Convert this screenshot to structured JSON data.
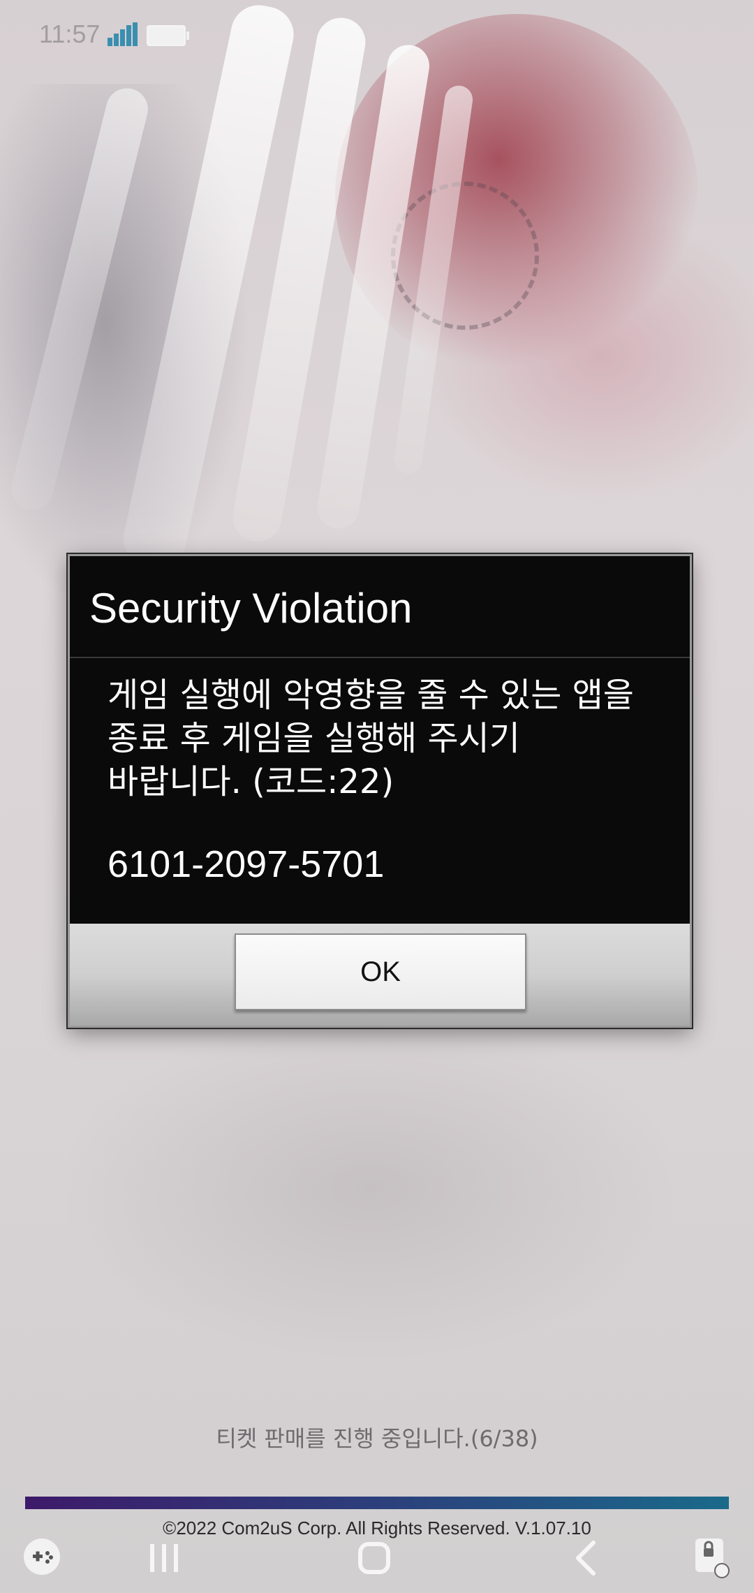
{
  "status_bar": {
    "time": "11:57",
    "signal_icon": "signal-bars-icon",
    "battery_icon": "battery-icon"
  },
  "dialog": {
    "title": "Security Violation",
    "message": "게임 실행에 악영향을 줄 수 있는 앱을\n종료 후 게임을 실행해 주시기\n바랍니다. (코드:22)",
    "code": "6101-2097-5701",
    "ok_label": "OK"
  },
  "loading": {
    "text": "티켓 판매를 진행 중입니다.(6/38)",
    "progress": 1.0,
    "progress_color_start": "#3d1a6a",
    "progress_color_end": "#1a6a8a"
  },
  "footer": {
    "copyright": "©2022 Com2uS Corp. All Rights Reserved. V.1.07.10"
  },
  "nav_bar": {
    "items": [
      "game-tools-icon",
      "recents-icon",
      "home-icon",
      "back-icon",
      "screen-lock-icon"
    ]
  },
  "colors": {
    "dialog_background": "#0a0a0a",
    "dialog_text": "#ffffff",
    "button_bar": "#cfcfcf"
  }
}
